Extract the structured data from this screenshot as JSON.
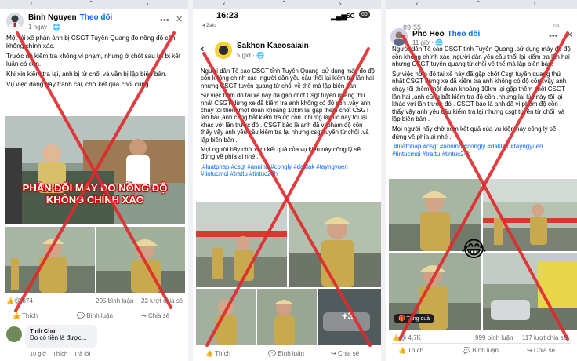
{
  "post1": {
    "author": "Bình Nguyen",
    "follow": "Theo dõi",
    "time": "1 ngày · ",
    "paragraphs": [
      "Một tài xế phản ánh bị CSGT Tuyên Quang đo nồng độ cồn không chính xác.",
      "Trước đó kiểm tra không vi phạm, nhưng ở chốt sau lại bị kết luận có cồn.",
      "Khi xin kiểm tra lại, anh bị từ chối và vẫn bị lập biên bản.",
      "Vụ việc đang gây tranh cãi, chờ kết quả chối cùng."
    ],
    "banner": "PHẢN ĐỐI MÁY ĐO NỒNG ĐỘ\nKHÔNG CHÍNH XÁC",
    "reaction_count": "874",
    "comments": "205 bình luận",
    "shares": "22 lượt chia sẻ",
    "like": "Thích",
    "comment": "Bình luận",
    "share": "Chia sẻ",
    "commenter": "Tinh Chu",
    "comment_text": "Đo có tiền là được...",
    "comment_time": "10 giờ",
    "comment_like": "Thích",
    "comment_reply": "Trả lời"
  },
  "post2": {
    "status_time": "16:23",
    "status_network": "5G",
    "status_battery": "66",
    "back_app": "◂ Zalo",
    "author": "Sakhon Kaeosaiain",
    "time": "5 giờ · ",
    "paragraphs": [
      "Người dân Tố cao CSGT tỉnh Tuyên Quang .sử dụng máy đo độ cồn không chính xác .người dân yêu cầu thổi lại kiểm tra lần hai nhưng CSGT tuyên quang từ chối về thể mà lập biên bản.",
      "Sự việc hôm đó tài xế này đã gặp chốt Csgt tuyên quang thứ nhất CSGT dừng xe đã kiểm tra anh không có độ cồn .vậy anh chạy tôi thêm một đoạn khoảng 10km lại gặp thêm chốt CSGT lần hai ,anh cũng bắt kiểm tra độ cồn .nhưng lại lúc này tôi lại khác với lần trước đó . CSGT bảo là anh đã vi phạm độ cồn . thấy vậy anh yêu cầu kiểm tra lại nhưng csgt tuyên từ chối .và lập biên bản .",
      "Mọi người hãy chờ xem kết quả của vụ kiện này công lý sẽ đứng về phía ai nhé ."
    ],
    "hashtags": ".#luatphap #csgt #anninh #congly #daklak #tayngyuen #tintucmoi #trattu #tintuc24h",
    "more_photos": "+3",
    "like": "Thích",
    "comment": "Bình luận",
    "share": "Chia sẻ"
  },
  "post3": {
    "status_time": "09:55",
    "status_battery": "64",
    "author": "Pho Heo",
    "follow": "Theo dõi",
    "time": "11 giờ · ",
    "paragraphs": [
      "Người dân Tố cao CSGT tỉnh Tuyên Quang .sử dụng máy đo độ cồn không chính xác .người dân yêu cầu thổi lại kiểm tra lần hai nhưng CSGT tuyên quang từ chối về thể mà lập biên bản.",
      "Sự việc hôm đó tài xế này đã gặp chốt Csgt tuyên quang thứ nhất CSGT dừng xe đã kiểm tra anh không có độ cồn .vậy anh chạy tôi thêm một đoạn khoảng 10km lại gặp thêm chốt CSGT lần hai ,anh cũng bắt kiểm tra độ cồn .nhưng lại lúc này tôi lại khác với lần trước đó . CSGT bảo là anh đã vi phạm độ cồn . thấy vậy anh yêu cầu kiểm tra lại nhưng csgt tuyên từ chối .và lập biên bản .",
      "Mọi người hãy chờ xem kết quả của vụ kiện này công lý sẽ đứng về phía ai nhé ."
    ],
    "hashtags": ".#luatphap #csgt #anninh #congly #daklak #tayngyuen #tintucmoi #trattu #tintuc24h",
    "gift_label": "Tặng quà",
    "reaction_count": "4,7K",
    "comments": "999 bình luận",
    "shares": "117 lượt chia sẻ",
    "like": "Thích",
    "comment": "Bình luận",
    "share": "Chia sẻ"
  },
  "colors": {
    "accent": "#0866ff",
    "cross": "#e0292b",
    "muted": "#65676b"
  }
}
